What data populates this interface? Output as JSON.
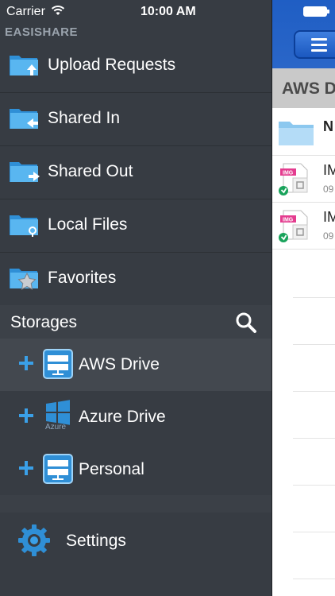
{
  "status_bar": {
    "carrier": "Carrier",
    "time": "10:00 AM"
  },
  "sidebar": {
    "app_title": "EASISHARE",
    "nav_items": [
      {
        "label": "Upload Requests",
        "icon": "folder-upload-icon"
      },
      {
        "label": "Shared In",
        "icon": "folder-shared-in-icon"
      },
      {
        "label": "Shared Out",
        "icon": "folder-shared-out-icon"
      },
      {
        "label": "Local Files",
        "icon": "folder-local-icon"
      },
      {
        "label": "Favorites",
        "icon": "folder-star-icon"
      }
    ],
    "storages": {
      "title": "Storages",
      "items": [
        {
          "label": "AWS Drive",
          "icon": "server-icon",
          "selected": true
        },
        {
          "label": "Azure Drive",
          "icon": "azure-icon",
          "sublabel": "Azure"
        },
        {
          "label": "Personal",
          "icon": "server-icon"
        }
      ]
    },
    "settings_label": "Settings"
  },
  "main": {
    "bar_title": "AWS D",
    "rows": [
      {
        "name": "N",
        "type": "folder"
      },
      {
        "name": "IM",
        "meta": "09",
        "type": "image"
      },
      {
        "name": "IM",
        "meta": "09",
        "type": "image"
      }
    ]
  },
  "colors": {
    "sidebar_bg": "#373c43",
    "accent_blue": "#2a66c8",
    "icon_blue": "#3aa0e8"
  }
}
